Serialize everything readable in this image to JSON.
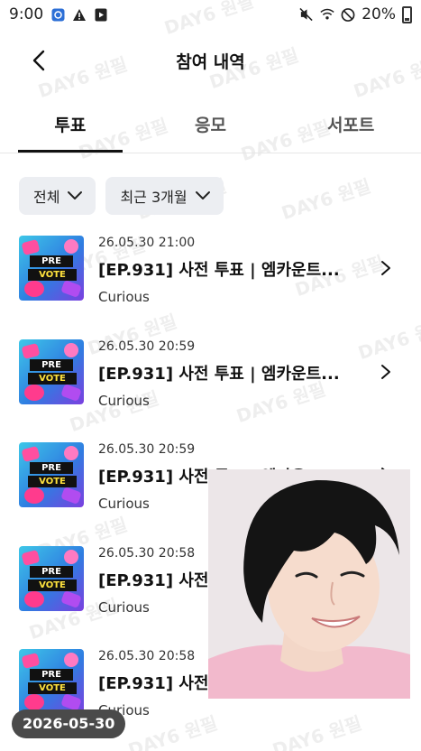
{
  "status_bar": {
    "time": "9:00",
    "battery": "20%",
    "icons_left": [
      "app-notification-icon",
      "warning-icon",
      "media-icon"
    ],
    "icons_right": [
      "mute-icon",
      "wifi-icon",
      "do-not-disturb-icon",
      "battery-icon"
    ]
  },
  "header": {
    "title": "참여 내역"
  },
  "tabs": [
    {
      "label": "투표",
      "active": true
    },
    {
      "label": "응모",
      "active": false
    },
    {
      "label": "서포트",
      "active": false
    }
  ],
  "filters": {
    "category": "전체",
    "period": "최근 3개월"
  },
  "items": [
    {
      "date": "26.05.30 21:00",
      "title": "[EP.931] 사전 투표 | 엠카운트...",
      "subtitle": "Curious",
      "thumb_top": "PRE",
      "thumb_bottom": "VOTE"
    },
    {
      "date": "26.05.30 20:59",
      "title": "[EP.931] 사전 투표 | 엠카운트...",
      "subtitle": "Curious",
      "thumb_top": "PRE",
      "thumb_bottom": "VOTE"
    },
    {
      "date": "26.05.30 20:59",
      "title": "[EP.931] 사전 투표 | 엠카운트...",
      "subtitle": "Curious",
      "thumb_top": "PRE",
      "thumb_bottom": "VOTE"
    },
    {
      "date": "26.05.30 20:58",
      "title": "[EP.931] 사전",
      "subtitle": "Curious",
      "thumb_top": "PRE",
      "thumb_bottom": "VOTE"
    },
    {
      "date": "26.05.30 20:58",
      "title": "[EP.931] 사전",
      "subtitle": "Curious",
      "thumb_top": "PRE",
      "thumb_bottom": "VOTE"
    }
  ],
  "watermark": "DAY6 원필",
  "date_badge": "2026-05-30",
  "colors": {
    "accent": "#111111",
    "chip_bg": "#eceef2",
    "badge_bg": "#4a4a4a"
  }
}
